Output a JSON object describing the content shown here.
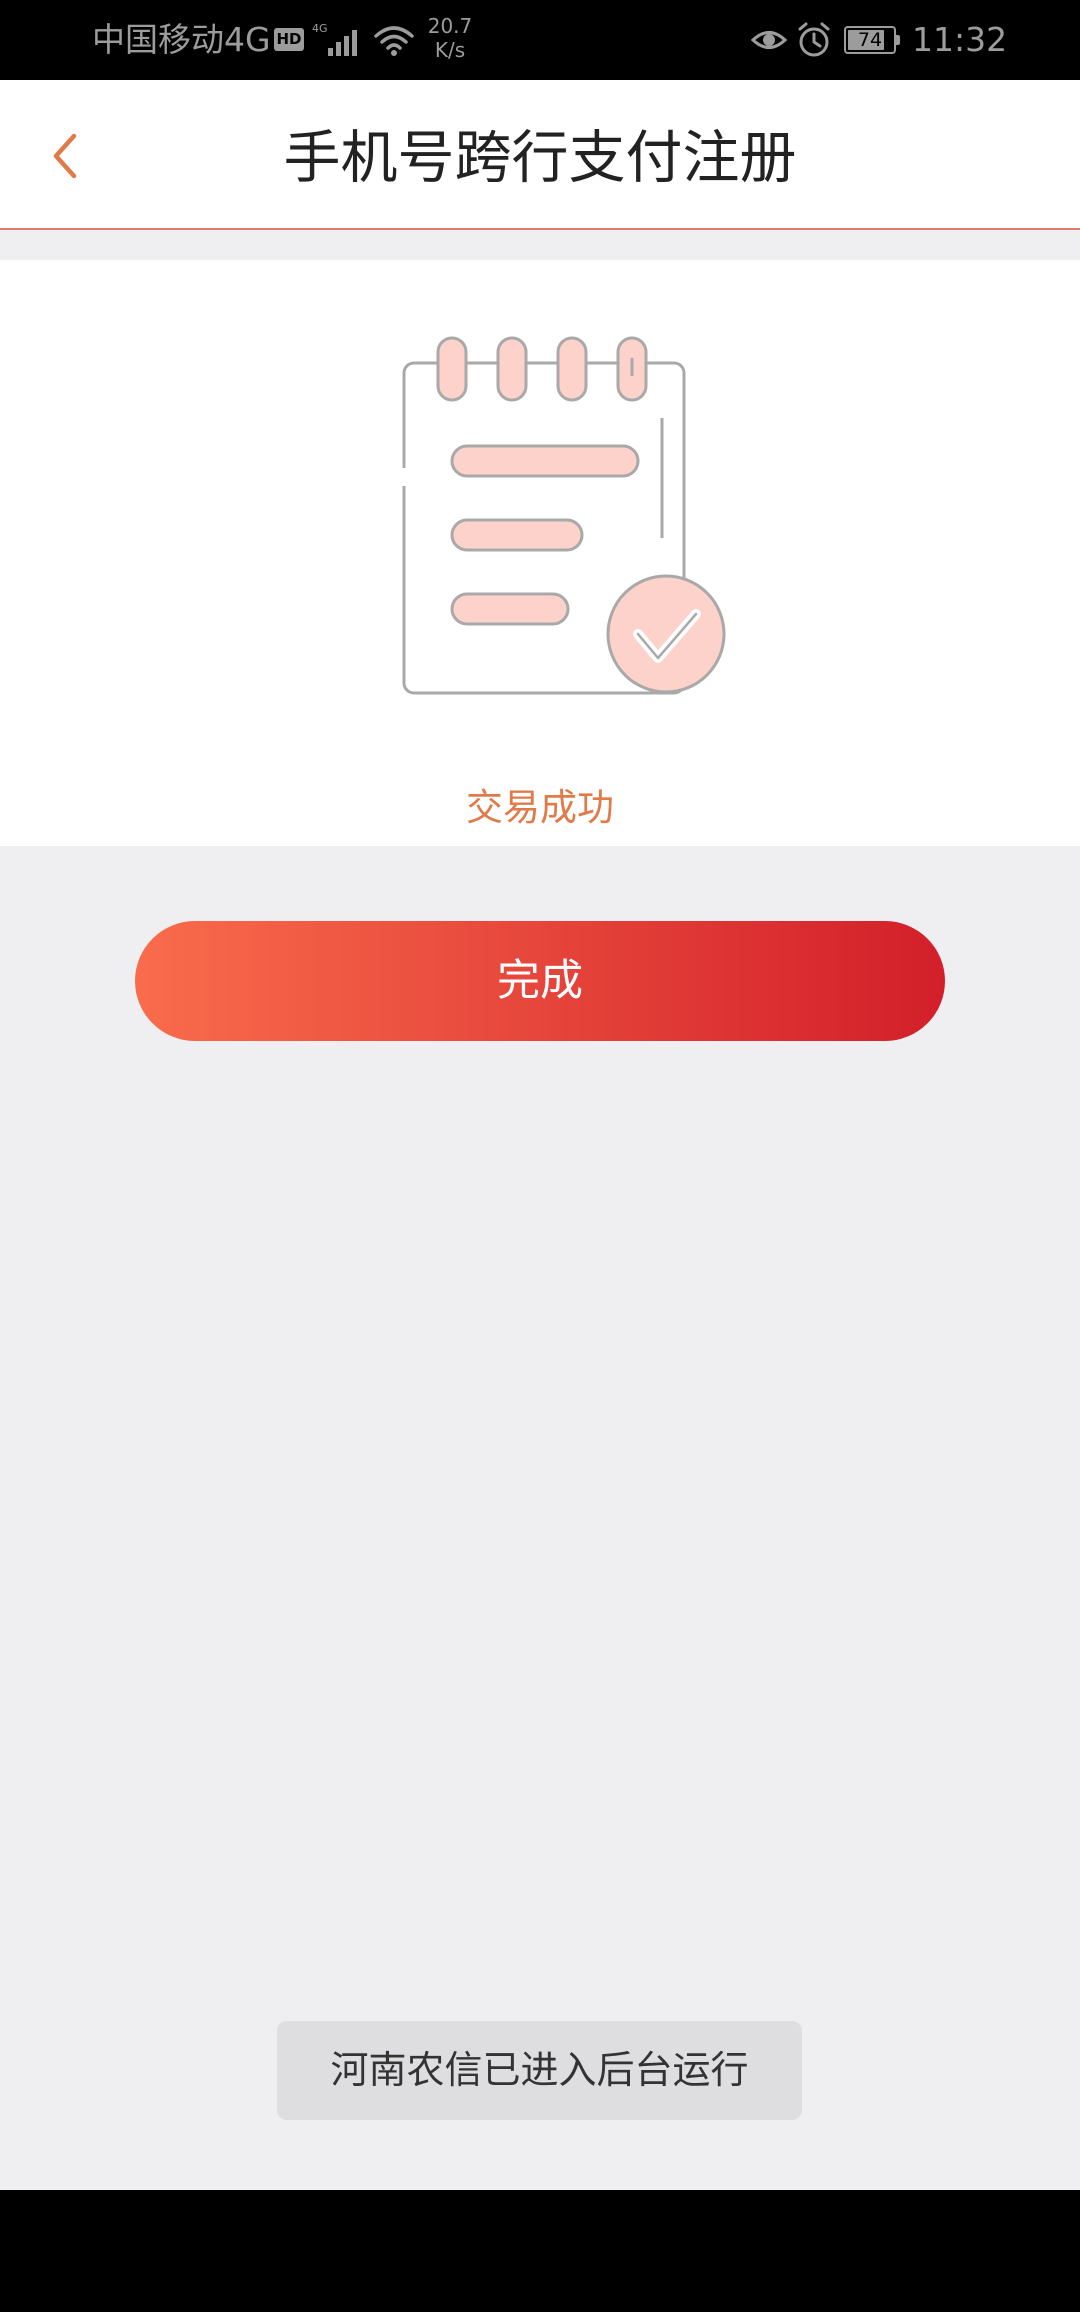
{
  "status_bar": {
    "carrier": "中国移动4G",
    "hd_badge": "HD",
    "network_speed_value": "20.7",
    "network_speed_unit": "K/s",
    "battery_percent": "74",
    "time": "11:32"
  },
  "nav": {
    "title": "手机号跨行支付注册"
  },
  "result": {
    "message": "交易成功"
  },
  "actions": {
    "done_label": "完成"
  },
  "toast": {
    "message": "河南农信已进入后台运行"
  },
  "colors": {
    "accent": "#e07b49",
    "button_gradient_start": "#f96c4c",
    "button_gradient_end": "#d31f2a",
    "illustration_fill": "#fcd2ca"
  },
  "icons": {
    "back": "chevron-left-icon",
    "illustration": "notepad-checkmark-icon",
    "signal": "signal-bars-icon",
    "wifi": "wifi-icon",
    "eye": "eye-comfort-icon",
    "alarm": "alarm-clock-icon",
    "battery": "battery-icon"
  }
}
